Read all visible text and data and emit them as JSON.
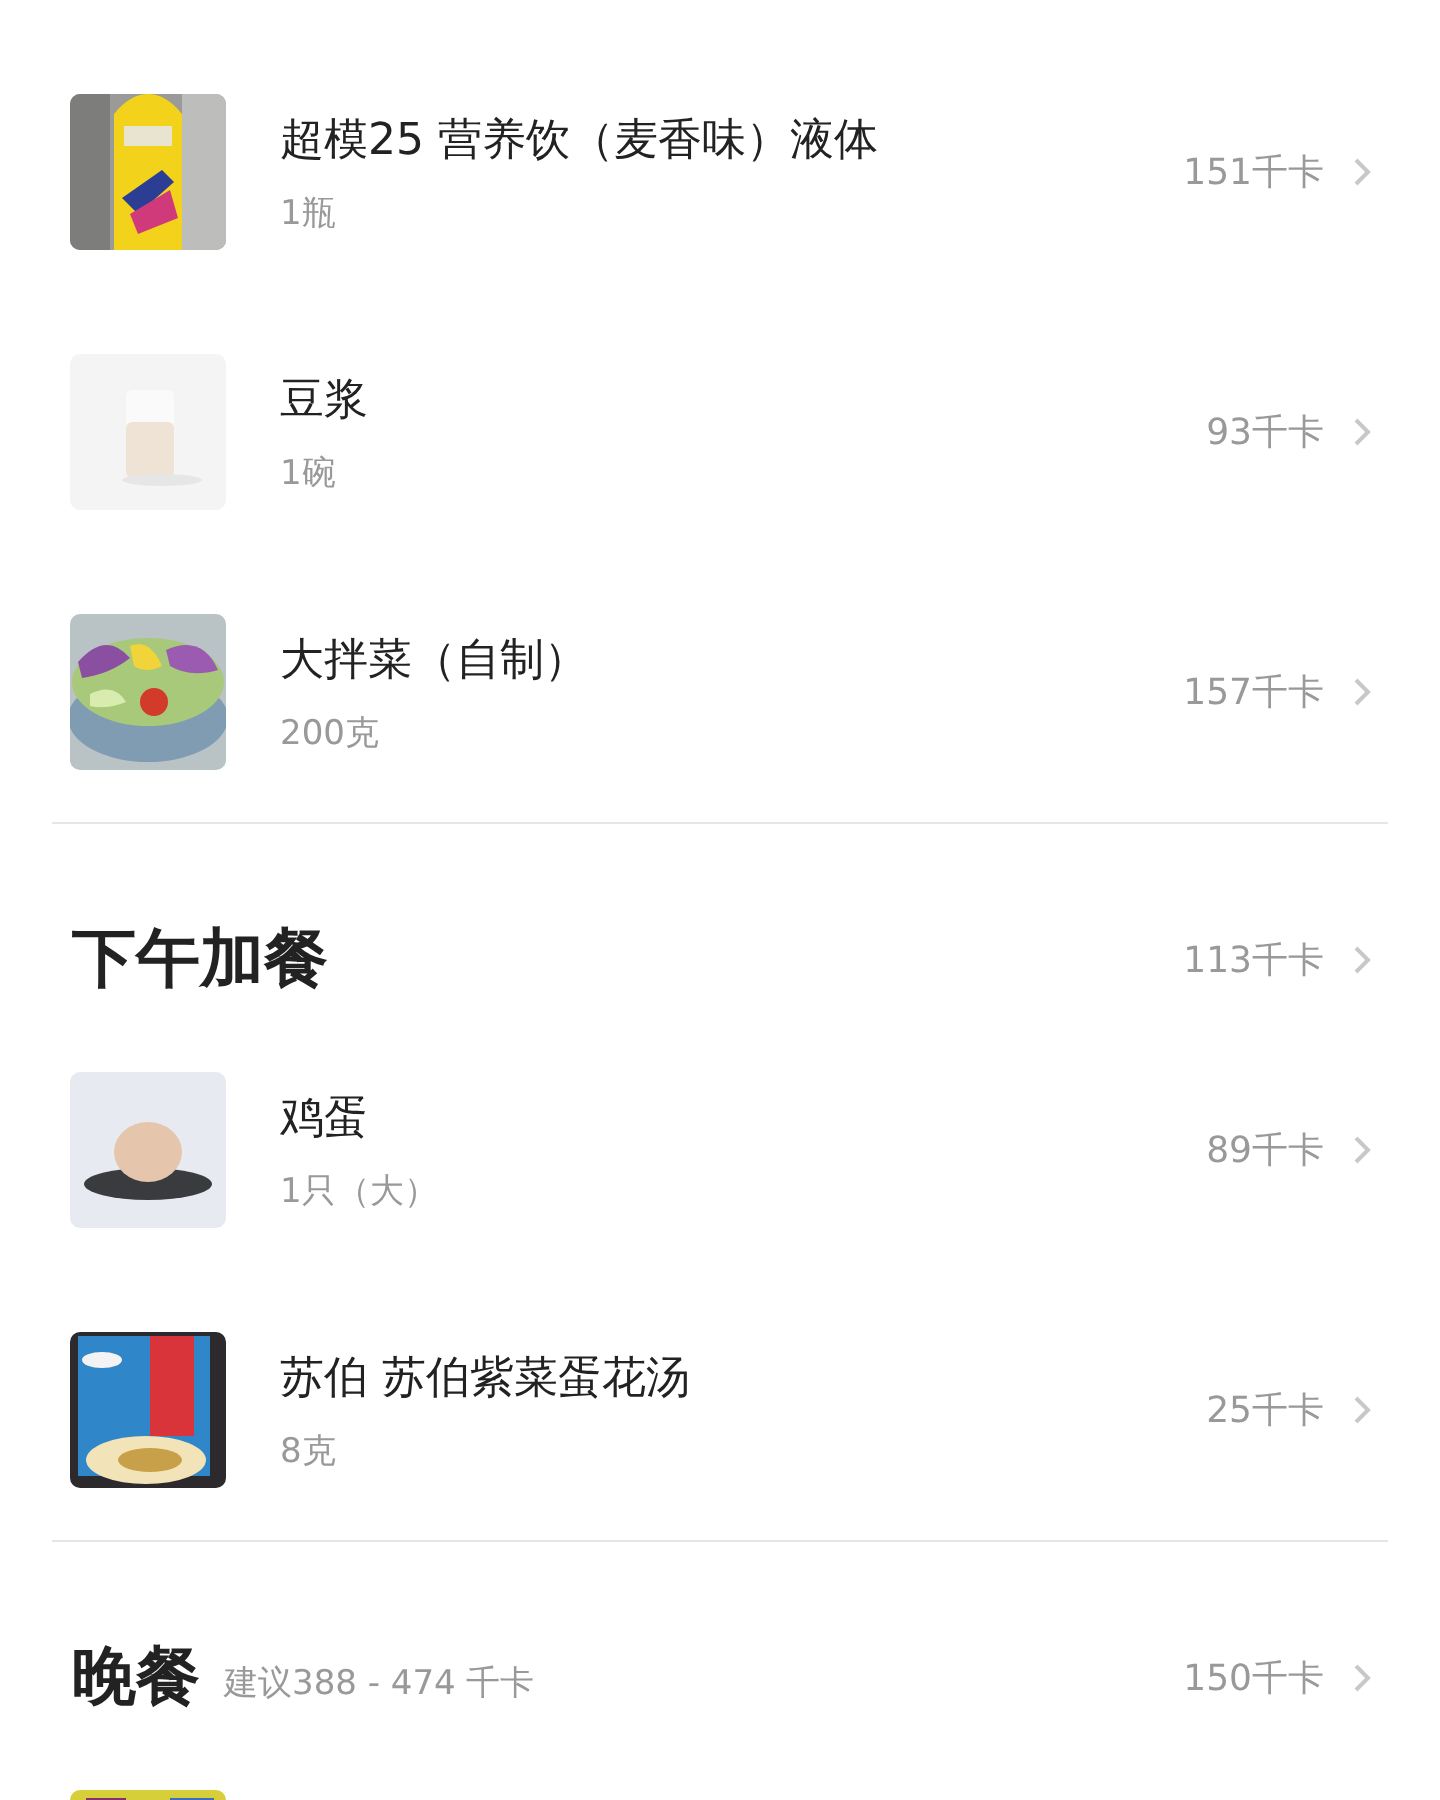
{
  "sections": [
    {
      "items": [
        {
          "kind": "picture",
          "name": "超模25 营养饮（麦香味）液体",
          "amount": "1瓶",
          "kcal": "151千卡"
        },
        {
          "kind": "picture",
          "name": "豆浆",
          "amount": "1碗",
          "kcal": "93千卡"
        },
        {
          "kind": "picture",
          "name": "大拌菜（自制）",
          "amount": "200克",
          "kcal": "157千卡"
        }
      ]
    },
    {
      "title": "下午加餐",
      "total": "113千卡",
      "items": [
        {
          "kind": "picture",
          "name": "鸡蛋",
          "amount": "1只（大）",
          "kcal": "89千卡"
        },
        {
          "kind": "picture",
          "name": "苏伯 苏伯紫菜蛋花汤",
          "amount": "8克",
          "kcal": "25千卡"
        }
      ]
    },
    {
      "title": "晚餐",
      "hint": "建议388 - 474 千卡",
      "total": "150千卡"
    }
  ]
}
